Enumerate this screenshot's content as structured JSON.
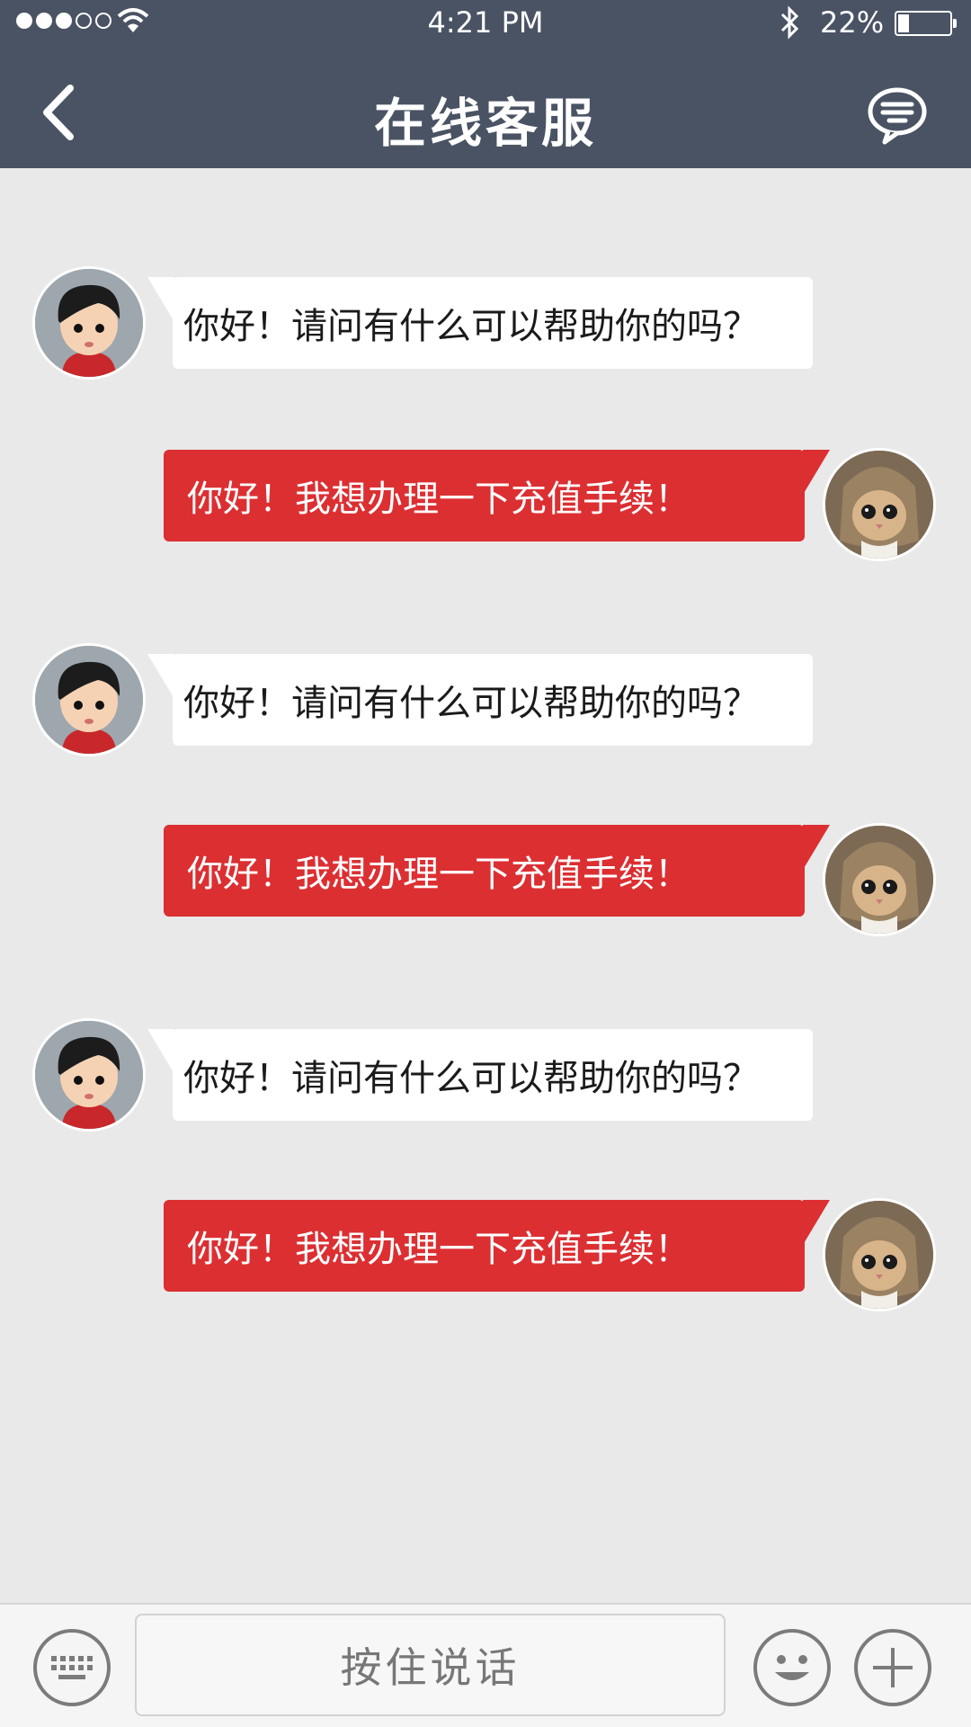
{
  "status_bar": {
    "time": "4:21 PM",
    "battery_percent": "22%",
    "battery_level": 0.22,
    "signal_bars_filled": 3,
    "signal_bars_total": 5
  },
  "nav": {
    "title": "在线客服",
    "back_icon": "chevron-left-icon",
    "right_icon": "message-bubble-icon"
  },
  "messages": [
    {
      "from": "agent",
      "text": "你好！请问有什么可以帮助你的吗？"
    },
    {
      "from": "user",
      "text": "你好！我想办理一下充值手续！"
    },
    {
      "from": "agent",
      "text": "你好！请问有什么可以帮助你的吗？"
    },
    {
      "from": "user",
      "text": "你好！我想办理一下充值手续！"
    },
    {
      "from": "agent",
      "text": "你好！请问有什么可以帮助你的吗？"
    },
    {
      "from": "user",
      "text": "你好！我想办理一下充值手续！"
    }
  ],
  "input_bar": {
    "hold_to_talk_label": "按住说话",
    "left_icon": "keyboard-icon",
    "emoji_icon": "smiley-icon",
    "plus_icon": "plus-icon"
  },
  "colors": {
    "header": "#4a5363",
    "user_bubble": "#dc2f32",
    "agent_bubble": "#ffffff",
    "background": "#e9e9e9"
  }
}
